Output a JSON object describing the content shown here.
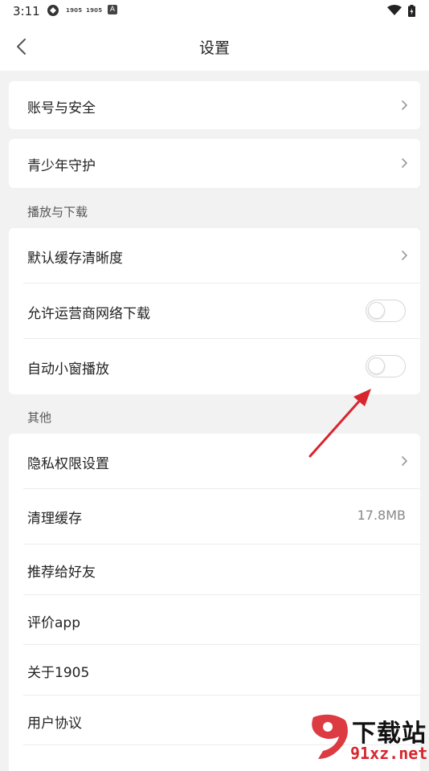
{
  "status_bar": {
    "time": "3:11",
    "badge1": "1905",
    "badge2": "1905",
    "badge3": "A"
  },
  "header": {
    "title": "设置"
  },
  "groups": {
    "account": {
      "label": "账号与安全"
    },
    "teen": {
      "label": "青少年守护"
    },
    "playback": {
      "section_title": "播放与下载",
      "items": [
        {
          "label": "默认缓存清晰度"
        },
        {
          "label": "允许运营商网络下载",
          "toggle": false
        },
        {
          "label": "自动小窗播放",
          "toggle": false
        }
      ]
    },
    "other": {
      "section_title": "其他",
      "items": [
        {
          "label": "隐私权限设置"
        },
        {
          "label": "清理缓存",
          "value": "17.8MB"
        },
        {
          "label": "推荐给好友"
        },
        {
          "label": "评价app"
        },
        {
          "label": "关于1905"
        },
        {
          "label": "用户协议"
        }
      ]
    }
  },
  "watermark": {
    "text": "下载站",
    "url": "91xz.net"
  },
  "colors": {
    "annotation_arrow": "#d8262e",
    "watermark_red": "#d8262e"
  }
}
